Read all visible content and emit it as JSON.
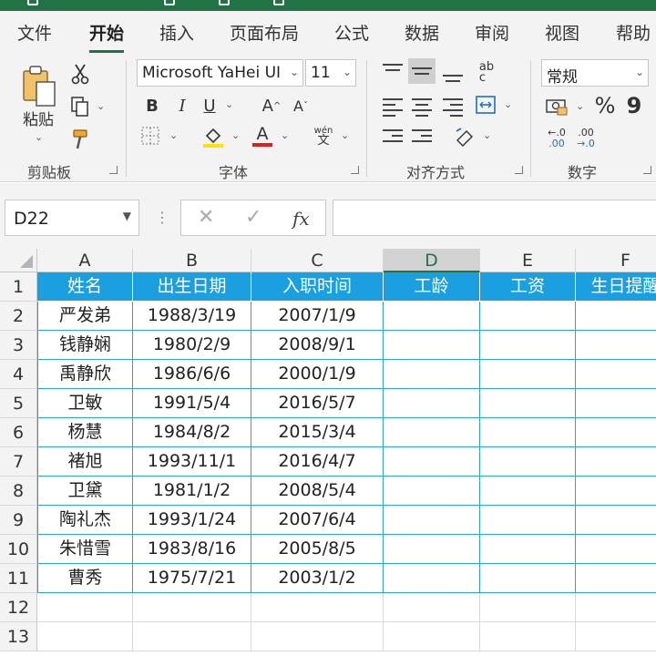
{
  "menu": {
    "tabs": [
      {
        "label": "文件"
      },
      {
        "label": "开始"
      },
      {
        "label": "插入"
      },
      {
        "label": "页面布局"
      },
      {
        "label": "公式"
      },
      {
        "label": "数据"
      },
      {
        "label": "审阅"
      },
      {
        "label": "视图"
      },
      {
        "label": "帮助"
      }
    ],
    "active_tab": "开始"
  },
  "ribbon": {
    "clipboard": {
      "group_label": "剪贴板",
      "paste_label": "粘贴"
    },
    "font": {
      "group_label": "字体",
      "font_name": "Microsoft YaHei UI",
      "font_size": "11",
      "bold": "B",
      "italic": "I",
      "underline": "U",
      "grow": "A",
      "shrink": "A",
      "font_color_letter": "A",
      "phonetic_top": "wén",
      "phonetic_bottom": "文"
    },
    "alignment": {
      "group_label": "对齐方式"
    },
    "number": {
      "group_label": "数字",
      "format": "常规",
      "percent": "%",
      "comma": "9",
      "inc_decimal": ".00",
      "dec_decimal": ".00"
    }
  },
  "formula_bar": {
    "name_box": "D22",
    "formula": ""
  },
  "sheet": {
    "selected_column": "D",
    "columns": [
      "A",
      "B",
      "C",
      "D",
      "E",
      "F"
    ],
    "rows": [
      "1",
      "2",
      "3",
      "4",
      "5",
      "6",
      "7",
      "8",
      "9",
      "10",
      "11",
      "12",
      "13"
    ],
    "headers": [
      "姓名",
      "出生日期",
      "入职时间",
      "工龄",
      "工资",
      "生日提醒"
    ],
    "data": [
      [
        "严发弟",
        "1988/3/19",
        "2007/1/9"
      ],
      [
        "钱静娴",
        "1980/2/9",
        "2008/9/1"
      ],
      [
        "禹静欣",
        "1986/6/6",
        "2000/1/9"
      ],
      [
        "卫敏",
        "1991/5/4",
        "2016/5/7"
      ],
      [
        "杨慧",
        "1984/8/2",
        "2015/3/4"
      ],
      [
        "褚旭",
        "1993/11/1",
        "2016/4/7"
      ],
      [
        "卫黛",
        "1981/1/2",
        "2008/5/4"
      ],
      [
        "陶礼杰",
        "1993/1/24",
        "2007/6/4"
      ],
      [
        "朱惜雪",
        "1983/8/16",
        "2005/8/5"
      ],
      [
        "曹秀",
        "1975/7/21",
        "2003/1/2"
      ]
    ]
  },
  "colors": {
    "header_fill": "#1aa0e0",
    "table_border": "#2aa8b8",
    "excel_green": "#217346",
    "font_color_bar": "#e0201b",
    "fill_color_bar": "#ffe000"
  }
}
